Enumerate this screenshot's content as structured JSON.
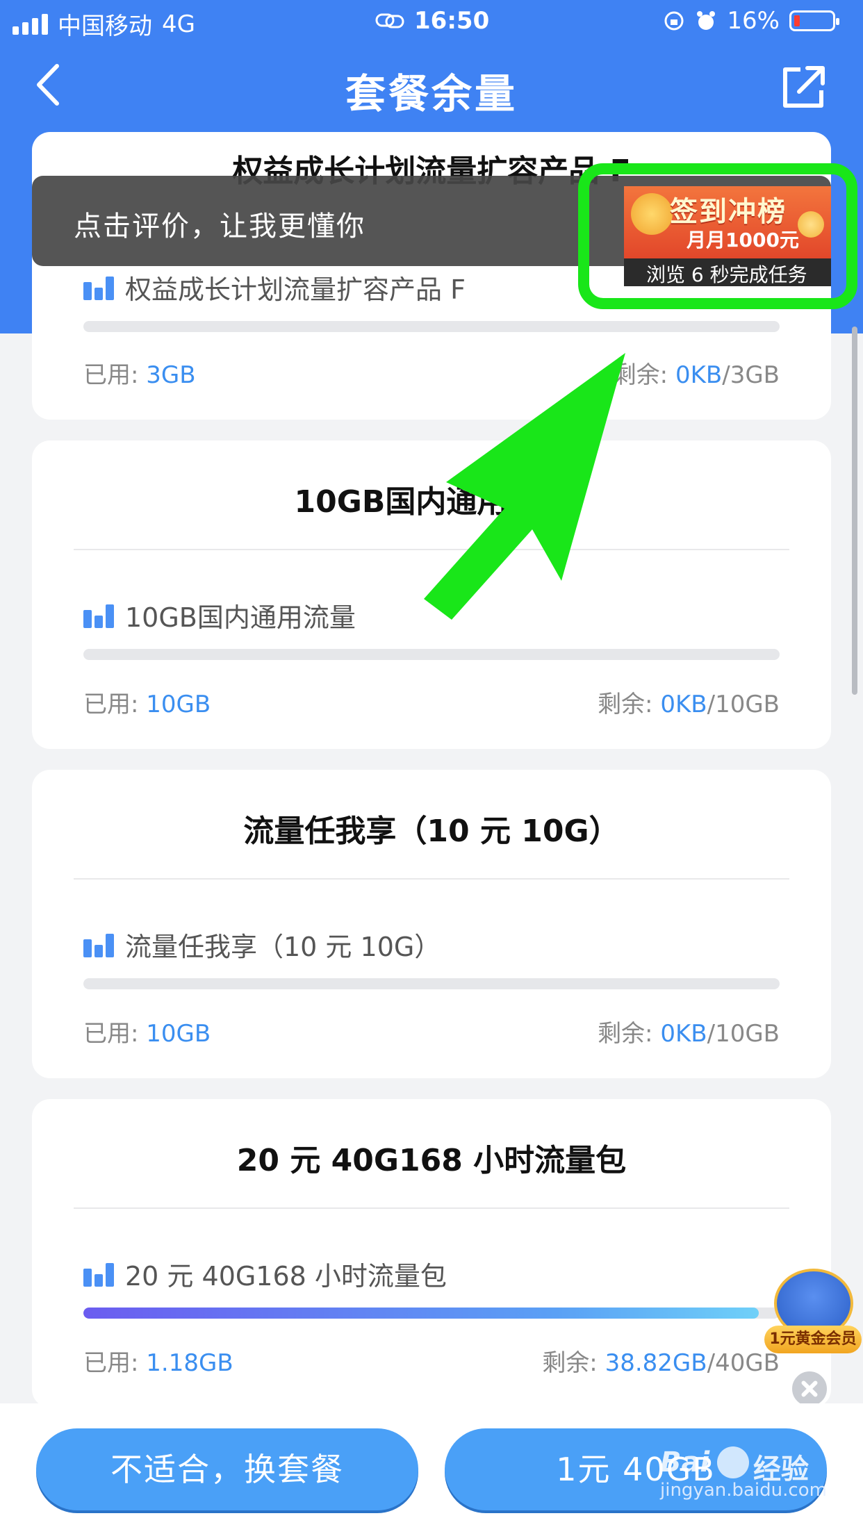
{
  "status_bar": {
    "carrier": "中国移动",
    "network": "4G",
    "time": "16:50",
    "battery": "16%"
  },
  "header": {
    "title": "套餐余量"
  },
  "toast": {
    "text": "点击评价，让我更懂你"
  },
  "ad": {
    "title": "签到冲榜",
    "subtitle": "月月1000元",
    "caption": "浏览 6 秒完成任务"
  },
  "packages": [
    {
      "title": "权益成长计划流量扩容产品 F",
      "item_label": "权益成长计划流量扩容产品 F",
      "used_label": "已用:",
      "used_value": "3GB",
      "remain_label": "剩余:",
      "remain_value": "0KB",
      "total": "/3GB",
      "remaining_fraction": 0
    },
    {
      "title": "10GB国内通用流量",
      "item_label": "10GB国内通用流量",
      "used_label": "已用:",
      "used_value": "10GB",
      "remain_label": "剩余:",
      "remain_value": "0KB",
      "total": "/10GB",
      "remaining_fraction": 0
    },
    {
      "title": "流量任我享（10 元 10G）",
      "item_label": "流量任我享（10 元 10G）",
      "used_label": "已用:",
      "used_value": "10GB",
      "remain_label": "剩余:",
      "remain_value": "0KB",
      "total": "/10GB",
      "remaining_fraction": 0
    },
    {
      "title": "20 元 40G168 小时流量包",
      "item_label": "20 元 40G168 小时流量包",
      "used_label": "已用:",
      "used_value": "1.18GB",
      "remain_label": "剩余:",
      "remain_value": "38.82GB",
      "total": "/40GB",
      "remaining_fraction": 0.97
    }
  ],
  "member_badge": {
    "label": "1元黄金会员"
  },
  "bottom": {
    "change_plan": "不适合，换套餐",
    "buy_button": "1元 40GB"
  },
  "watermark": {
    "brand": "Bai",
    "brand2": "经验",
    "url": "jingyan.baidu.com"
  },
  "colors": {
    "header_blue": "#3f82f3",
    "accent_value": "#3a8ef0",
    "highlight_green": "#19e619"
  }
}
